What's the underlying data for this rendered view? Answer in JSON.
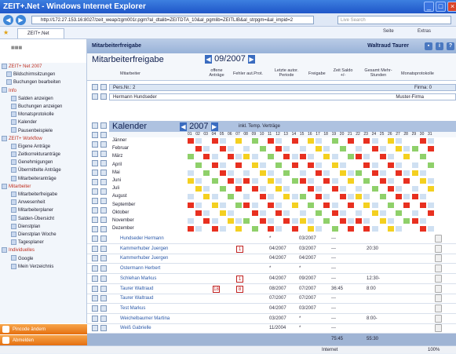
{
  "window": {
    "title": "ZEIT+.Net - Windows Internet Explorer"
  },
  "browser": {
    "url": "http://172.27.153.16:8027/zeit_weap/zgm001r.pgm?al_dtalib=ZEITDTA_10&al_pgmlib=ZEITLIB&al_strpgm=&al_impid=2",
    "search_placeholder": "Live Search",
    "tab_label": "ZEIT+.Net",
    "tools": [
      "Seite",
      "Extras"
    ]
  },
  "sidebar": {
    "header": "ZEIT+ Net 2007",
    "items": [
      {
        "label": "Bildschirmsitzungen",
        "level": 1
      },
      {
        "label": "Buchungen bearbeiten",
        "level": 1
      },
      {
        "label": "Info",
        "level": 0
      },
      {
        "label": "Salden anzeigen",
        "level": 2
      },
      {
        "label": "Buchungen anzeigen",
        "level": 2
      },
      {
        "label": "Monatsprotokolle",
        "level": 2
      },
      {
        "label": "Kalender",
        "level": 2
      },
      {
        "label": "Pausenbeispiele",
        "level": 2
      },
      {
        "label": "ZEIT+ Workflow",
        "level": 0
      },
      {
        "label": "Eigene Anträge",
        "level": 2
      },
      {
        "label": "Zeitkorrekturanträge",
        "level": 2
      },
      {
        "label": "Genehmigungen",
        "level": 2
      },
      {
        "label": "Übermittelte Anträge",
        "level": 2
      },
      {
        "label": "Mitarbeiteranträge",
        "level": 2
      },
      {
        "label": "Mitarbeiter",
        "level": 0
      },
      {
        "label": "Mitarbeiterfreigabe",
        "level": 2
      },
      {
        "label": "Anwesenheit",
        "level": 2
      },
      {
        "label": "Mitarbeiterplaner",
        "level": 2
      },
      {
        "label": "Salden-Übersicht",
        "level": 2
      },
      {
        "label": "Dienstplan",
        "level": 2
      },
      {
        "label": "Dienstplan Woche",
        "level": 2
      },
      {
        "label": "Tagesplaner",
        "level": 2
      },
      {
        "label": "Individuelles",
        "level": 0
      },
      {
        "label": "Google",
        "level": 2
      },
      {
        "label": "Mein Verzeichnis",
        "level": 2
      }
    ],
    "buttons": [
      "Pincode ändern",
      "Abmelden"
    ]
  },
  "header": {
    "title": "Mitarbeiterfreigabe",
    "user": "Waltraud Taurer"
  },
  "main": {
    "title": "Mitarbeiterfreigabe",
    "period": "09/2007",
    "columns": [
      "Mitarbeiter",
      "offene Anträge",
      "Fehler aut.Prot.",
      "Letzte autor. Periode",
      "Freigabe",
      "Zeit Saldo +/-",
      "Gesamt Mehr-Stunden",
      "Monatsprotokolle"
    ],
    "pers_label": "Pers.Nr.: 2",
    "firma_label": "Firma: 0",
    "emp_name": "Hermann Hundseder",
    "firma_name": "Muster-Firma",
    "calendar": {
      "title": "Kalender",
      "year": "2007",
      "subtitle": "inkl. Temp. Verträge",
      "months": [
        "Jänner",
        "Februar",
        "März",
        "April",
        "Mai",
        "Juni",
        "Juli",
        "August",
        "September",
        "Oktober",
        "November",
        "Dezember"
      ]
    },
    "rows": [
      {
        "name": "Hundseder Hermann",
        "c1": "",
        "c2": "",
        "per": "*",
        "frei": "03/2007",
        "saldo": "---",
        "mehr": ""
      },
      {
        "name": "Kammerhuber Juergen",
        "c1": "",
        "c2": "1",
        "per": "04/2007",
        "frei": "03/2007",
        "saldo": "---",
        "mehr": "20:30"
      },
      {
        "name": "Kammerhuber Juergen",
        "c1": "",
        "c2": "",
        "per": "04/2007",
        "frei": "04/2007",
        "saldo": "---",
        "mehr": ""
      },
      {
        "name": "Ostermann Herbert",
        "c1": "",
        "c2": "",
        "per": "*",
        "frei": "*",
        "saldo": "---",
        "mehr": ""
      },
      {
        "name": "Schlehan Markus",
        "c1": "",
        "c2": "1",
        "per": "04/2007",
        "frei": "09/2007",
        "saldo": "---",
        "mehr": "12:30-"
      },
      {
        "name": "Taurer Waltraud",
        "c1": "18",
        "c2": "8",
        "per": "08/2007",
        "frei": "07/2007",
        "saldo": "36:45",
        "mehr": "8:00"
      },
      {
        "name": "Taurer Waltraud",
        "c1": "",
        "c2": "",
        "per": "07/2007",
        "frei": "07/2007",
        "saldo": "---",
        "mehr": ""
      },
      {
        "name": "Test Markus",
        "c1": "",
        "c2": "",
        "per": "04/2007",
        "frei": "03/2007",
        "saldo": "---",
        "mehr": ""
      },
      {
        "name": "Weichelbaumer Martina",
        "c1": "",
        "c2": "",
        "per": "03/2007",
        "frei": "*",
        "saldo": "---",
        "mehr": "8:00-"
      },
      {
        "name": "Weiß Gabrielle",
        "c1": "",
        "c2": "",
        "per": "11/2004",
        "frei": "*",
        "saldo": "---",
        "mehr": ""
      }
    ],
    "footer": {
      "saldo": "75:45",
      "mehr": "55:30"
    }
  },
  "status": {
    "zone": "Internet",
    "zoom": "100%"
  },
  "colors": {
    "accent": "#1f56c8",
    "header": "#98b2d8",
    "orange": "#e56f10"
  }
}
